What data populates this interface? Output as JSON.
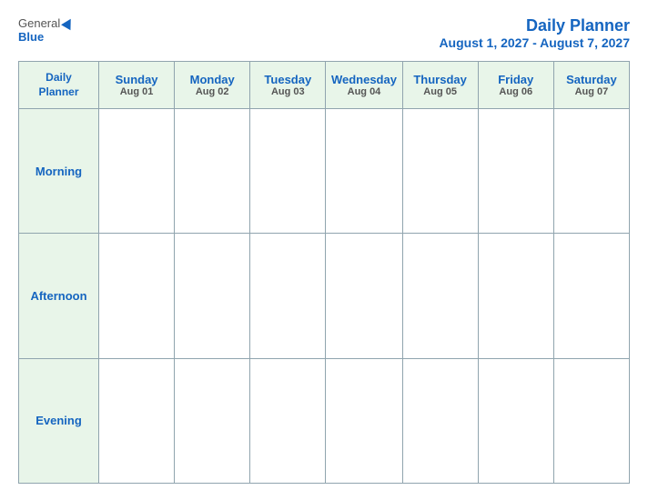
{
  "header": {
    "logo_general": "General",
    "logo_blue": "Blue",
    "title": "Daily Planner",
    "date_range": "August 1, 2027 - August 7, 2027"
  },
  "columns": [
    {
      "id": "daily-planner-col",
      "name": "Daily",
      "name2": "Planner",
      "date": ""
    },
    {
      "id": "sunday-col",
      "name": "Sunday",
      "date": "Aug 01"
    },
    {
      "id": "monday-col",
      "name": "Monday",
      "date": "Aug 02"
    },
    {
      "id": "tuesday-col",
      "name": "Tuesday",
      "date": "Aug 03"
    },
    {
      "id": "wednesday-col",
      "name": "Wednesday",
      "date": "Aug 04"
    },
    {
      "id": "thursday-col",
      "name": "Thursday",
      "date": "Aug 05"
    },
    {
      "id": "friday-col",
      "name": "Friday",
      "date": "Aug 06"
    },
    {
      "id": "saturday-col",
      "name": "Saturday",
      "date": "Aug 07"
    }
  ],
  "rows": [
    {
      "id": "morning",
      "label": "Morning"
    },
    {
      "id": "afternoon",
      "label": "Afternoon"
    },
    {
      "id": "evening",
      "label": "Evening"
    }
  ]
}
